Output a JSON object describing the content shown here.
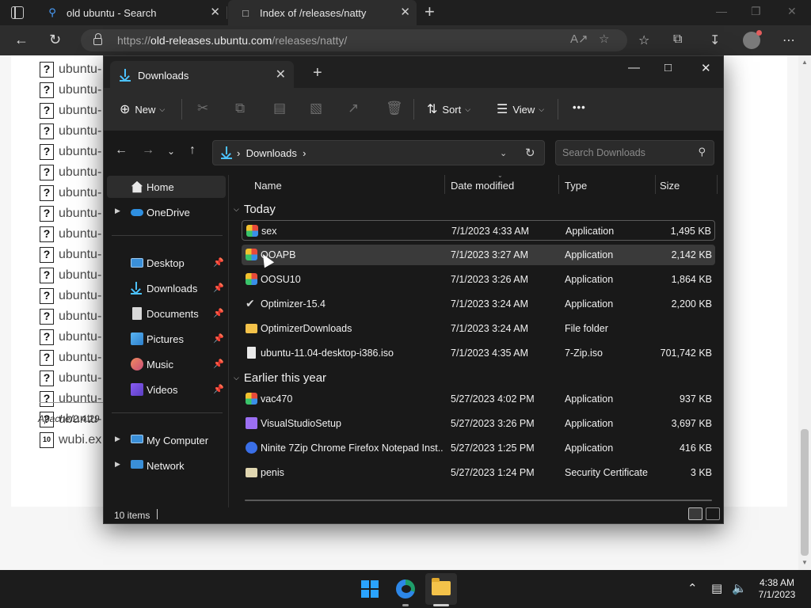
{
  "browser": {
    "tabs": [
      {
        "label": "old ubuntu - Search",
        "icon": "search-icon"
      },
      {
        "label": "Index of /releases/natty",
        "icon": "page-icon"
      }
    ],
    "url_prefix": "https://",
    "url_host": "old-releases.ubuntu.com",
    "url_path": "/releases/natty/"
  },
  "webpage": {
    "rows": [
      "ubuntu-",
      "ubuntu-",
      "ubuntu-",
      "ubuntu-",
      "ubuntu-",
      "ubuntu-",
      "ubuntu-",
      "ubuntu-",
      "ubuntu-",
      "ubuntu-",
      "ubuntu-",
      "ubuntu-",
      "ubuntu-",
      "ubuntu-",
      "ubuntu-",
      "ubuntu-",
      "ubuntu-",
      "ubuntu-"
    ],
    "last_row": "wubi.ex",
    "footer": "Apache/2.4.29"
  },
  "explorer": {
    "tab_title": "Downloads",
    "toolbar": {
      "new_label": "New",
      "sort_label": "Sort",
      "view_label": "View",
      "more_label": "•••"
    },
    "address": {
      "crumb": "Downloads"
    },
    "search_placeholder": "Search Downloads",
    "sidebar": [
      {
        "label": "Home",
        "icon": "home-icon"
      },
      {
        "label": "OneDrive",
        "icon": "onedrive-icon"
      },
      {
        "label": "Desktop",
        "icon": "desktop-icon"
      },
      {
        "label": "Downloads",
        "icon": "downloads-icon"
      },
      {
        "label": "Documents",
        "icon": "documents-icon"
      },
      {
        "label": "Pictures",
        "icon": "pictures-icon"
      },
      {
        "label": "Music",
        "icon": "music-icon"
      },
      {
        "label": "Videos",
        "icon": "videos-icon"
      },
      {
        "label": "My Computer",
        "icon": "computer-icon"
      },
      {
        "label": "Network",
        "icon": "network-icon"
      }
    ],
    "columns": {
      "name": "Name",
      "date": "Date modified",
      "type": "Type",
      "size": "Size"
    },
    "groups": [
      {
        "label": "Today",
        "files": [
          {
            "name": "sex",
            "date": "7/1/2023 4:33 AM",
            "type": "Application",
            "size": "1,495 KB",
            "icon": "app-icon"
          },
          {
            "name": "OOAPB",
            "date": "7/1/2023 3:27 AM",
            "type": "Application",
            "size": "2,142 KB",
            "icon": "app-icon"
          },
          {
            "name": "OOSU10",
            "date": "7/1/2023 3:26 AM",
            "type": "Application",
            "size": "1,864 KB",
            "icon": "app-icon"
          },
          {
            "name": "Optimizer-15.4",
            "date": "7/1/2023 3:24 AM",
            "type": "Application",
            "size": "2,200 KB",
            "icon": "check-icon"
          },
          {
            "name": "OptimizerDownloads",
            "date": "7/1/2023 3:24 AM",
            "type": "File folder",
            "size": "",
            "icon": "folder-icon"
          },
          {
            "name": "ubuntu-11.04-desktop-i386.iso",
            "date": "7/1/2023 4:35 AM",
            "type": "7-Zip.iso",
            "size": "701,742 KB",
            "icon": "file-icon"
          }
        ]
      },
      {
        "label": "Earlier this year",
        "files": [
          {
            "name": "vac470",
            "date": "5/27/2023 4:02 PM",
            "type": "Application",
            "size": "937 KB",
            "icon": "app-icon"
          },
          {
            "name": "VisualStudioSetup",
            "date": "5/27/2023 3:26 PM",
            "type": "Application",
            "size": "3,697 KB",
            "icon": "visualstudio-icon"
          },
          {
            "name": "Ninite 7Zip Chrome Firefox Notepad Inst...",
            "date": "5/27/2023 1:25 PM",
            "type": "Application",
            "size": "416 KB",
            "icon": "ninite-icon"
          },
          {
            "name": "penis",
            "date": "5/27/2023 1:24 PM",
            "type": "Security Certificate",
            "size": "3 KB",
            "icon": "certificate-icon"
          }
        ]
      }
    ],
    "status": "10 items"
  },
  "taskbar": {
    "time": "4:38 AM",
    "date": "7/1/2023"
  },
  "colors": {
    "accent": "#4cc2ff",
    "explorer_bg": "#191919",
    "toolbar_bg": "#2b2b2b"
  }
}
